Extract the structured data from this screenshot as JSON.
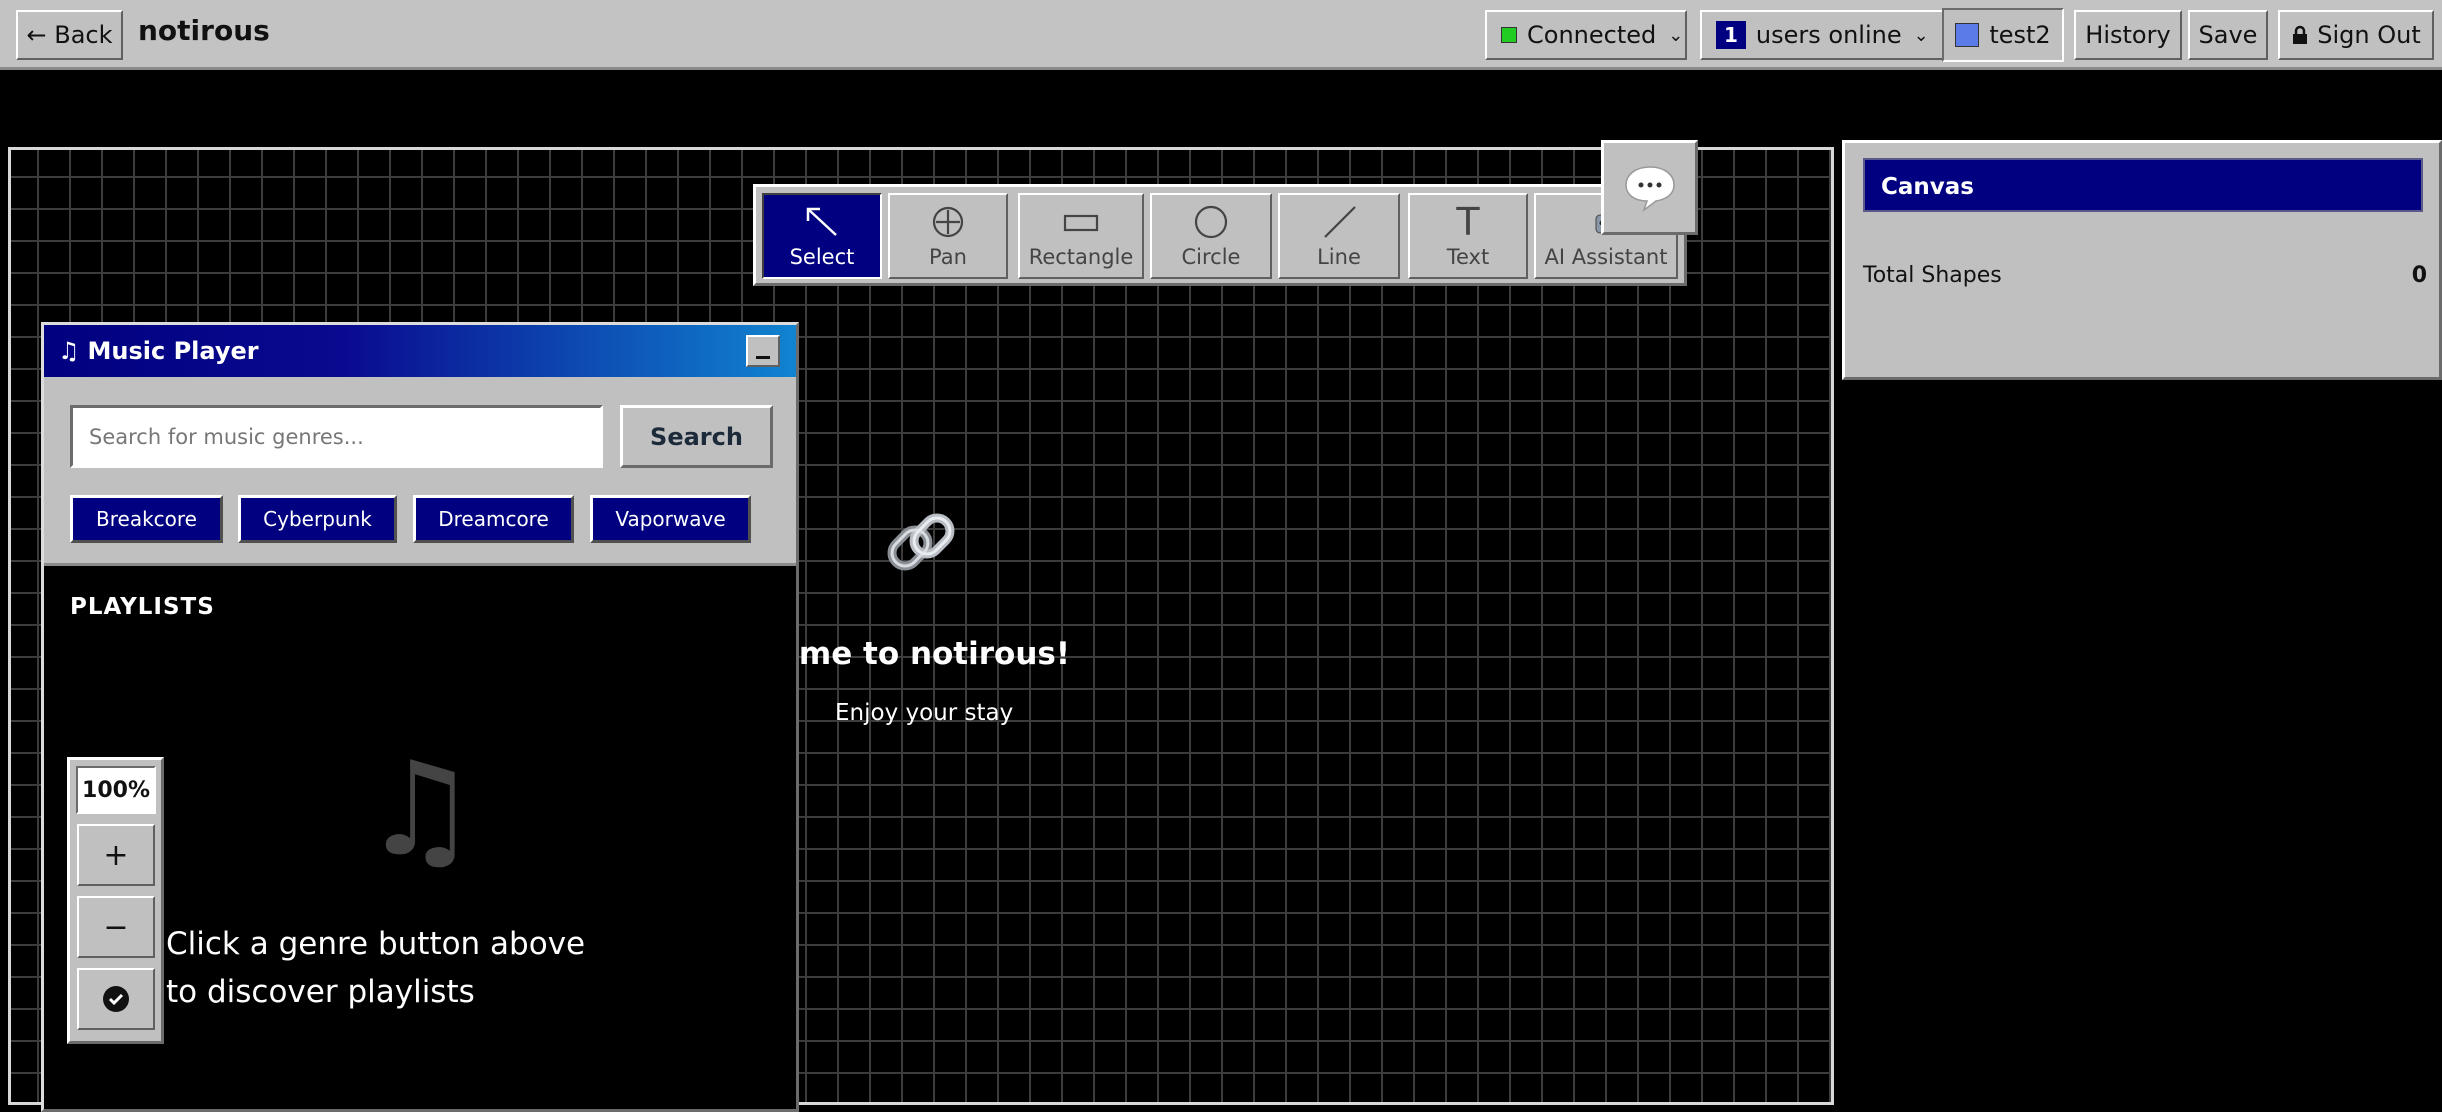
{
  "header": {
    "back_label": "← Back",
    "app_title": "notirous",
    "connection_status": "Connected",
    "users_online_count": "1",
    "users_online_label": "users online",
    "current_user": "test2",
    "history_label": "History",
    "save_label": "Save",
    "signout_label": "Sign Out"
  },
  "toolbar": {
    "tools": [
      {
        "label": "Select",
        "icon": "arrow-icon",
        "active": true
      },
      {
        "label": "Pan",
        "icon": "crosshair-icon"
      },
      {
        "label": "Rectangle",
        "icon": "rectangle-icon"
      },
      {
        "label": "Circle",
        "icon": "circle-icon"
      },
      {
        "label": "Line",
        "icon": "line-icon"
      },
      {
        "label": "Text",
        "icon": "text-icon",
        "glyph": "T"
      },
      {
        "label": "AI Assistant",
        "icon": "robot-icon"
      }
    ]
  },
  "chat": {
    "glyph": "···"
  },
  "panel": {
    "title": "Canvas",
    "total_shapes_label": "Total Shapes",
    "total_shapes_value": "0"
  },
  "welcome": {
    "title": "Welcome to notirous!",
    "subtitle": "Enjoy your stay"
  },
  "music_player": {
    "title": "Music Player",
    "search_placeholder": "Search for music genres...",
    "search_button": "Search",
    "genres": [
      "Breakcore",
      "Cyberpunk",
      "Dreamcore",
      "Vaporwave"
    ],
    "playlists_heading": "PLAYLISTS",
    "hint": "Click a genre button above to discover playlists"
  },
  "zoom": {
    "level": "100%",
    "plus": "+",
    "minus": "−"
  },
  "colors": {
    "accent": "#000080",
    "chrome": "#c0c0c0",
    "background": "#000000",
    "connected": "#22cc22",
    "user_swatch": "#5b7be8"
  }
}
